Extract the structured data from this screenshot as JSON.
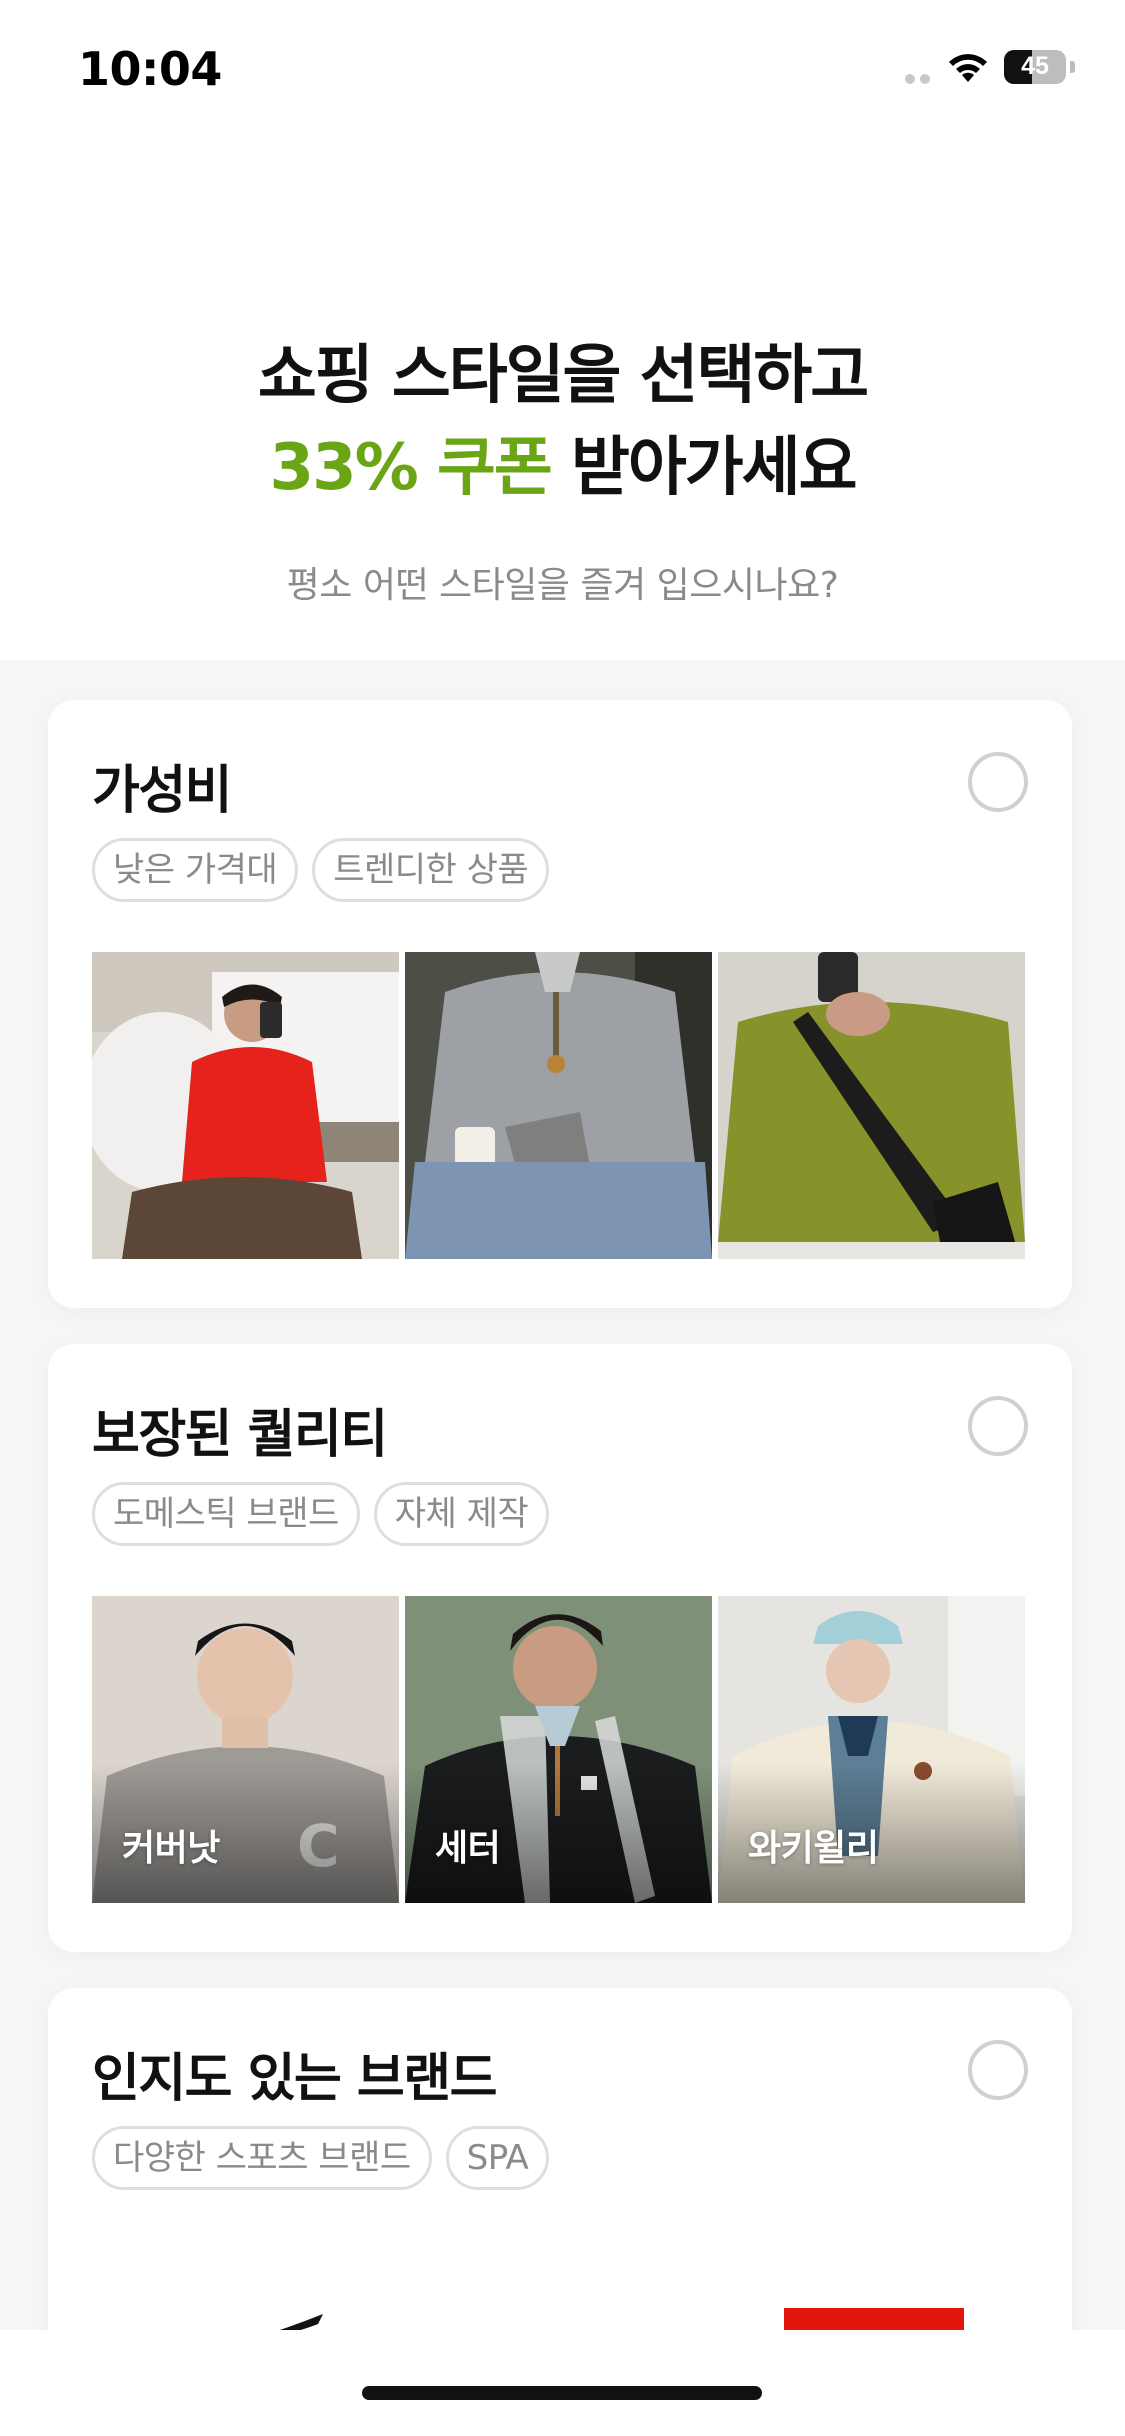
{
  "status_bar": {
    "time": "10:04",
    "battery": "45",
    "battery_level": 0.45
  },
  "hero": {
    "title_line1": "쇼핑 스타일을 선택하고",
    "title_accent": "33% 쿠폰",
    "title_rest": " 받아가세요",
    "subtitle": "평소 어떤 스타일을 즐겨 입으시나요?"
  },
  "colors": {
    "accent": "#6aa515",
    "brand_red": "#e3150f"
  },
  "cards": [
    {
      "title": "가성비",
      "tags": [
        "낮은 가격대",
        "트렌디한 상품"
      ],
      "photos": [
        {
          "label": "",
          "icon": "red-sweater-photo"
        },
        {
          "label": "",
          "icon": "gray-knit-photo"
        },
        {
          "label": "",
          "icon": "green-sweater-photo"
        }
      ]
    },
    {
      "title": "보장된 퀄리티",
      "tags": [
        "도메스틱 브랜드",
        "자체 제작"
      ],
      "photos": [
        {
          "label": "커버낫",
          "icon": "gray-sweatshirt-photo"
        },
        {
          "label": "세터",
          "icon": "track-jacket-photo"
        },
        {
          "label": "와키윌리",
          "icon": "puffer-jacket-photo"
        }
      ]
    },
    {
      "title": "인지도 있는 브랜드",
      "tags": [
        "다양한 스포츠 브랜드",
        "SPA"
      ]
    }
  ]
}
